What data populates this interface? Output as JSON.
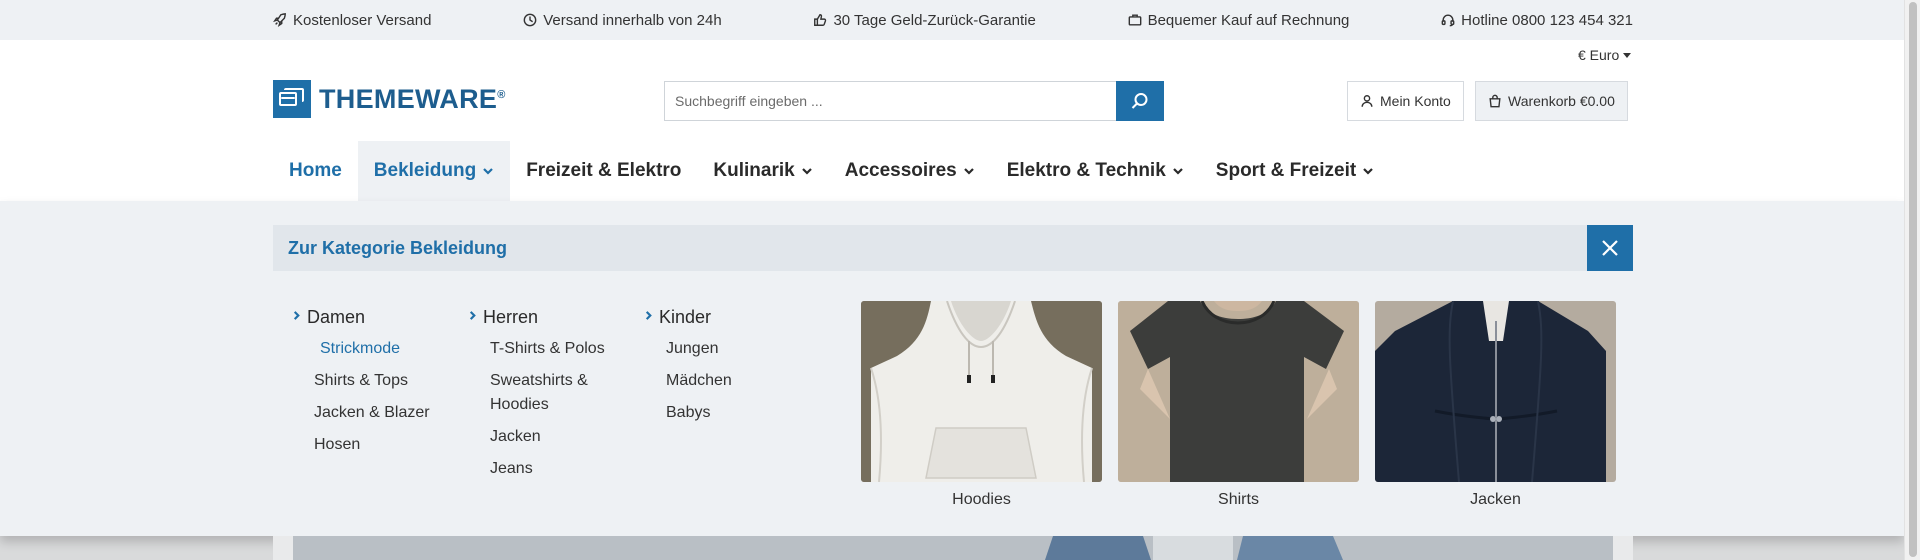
{
  "topbar": {
    "items": [
      {
        "icon": "rocket-icon",
        "label": "Kostenloser Versand"
      },
      {
        "icon": "clock-icon",
        "label": "Versand innerhalb von 24h"
      },
      {
        "icon": "thumbs-up-icon",
        "label": "30 Tage Geld-Zurück-Garantie"
      },
      {
        "icon": "briefcase-icon",
        "label": "Bequemer Kauf auf Rechnung"
      },
      {
        "icon": "headset-icon",
        "label": "Hotline 0800 123 454 321"
      }
    ]
  },
  "header": {
    "currency": "€ Euro",
    "logo_text": "THEMEWARE",
    "logo_mark": "®",
    "search_placeholder": "Suchbegriff eingeben ...",
    "account_label": "Mein Konto",
    "cart_label": "Warenkorb €0.00"
  },
  "nav": {
    "items": [
      {
        "label": "Home",
        "dropdown": false
      },
      {
        "label": "Bekleidung",
        "dropdown": true
      },
      {
        "label": "Freizeit & Elektro",
        "dropdown": false
      },
      {
        "label": "Kulinarik",
        "dropdown": true
      },
      {
        "label": "Accessoires",
        "dropdown": true
      },
      {
        "label": "Elektro & Technik",
        "dropdown": true
      },
      {
        "label": "Sport & Freizeit",
        "dropdown": true
      }
    ]
  },
  "mega": {
    "heading": "Zur Kategorie Bekleidung",
    "columns": [
      {
        "title": "Damen",
        "items": [
          "Strickmode",
          "Shirts & Tops",
          "Jacken & Blazer",
          "Hosen"
        ]
      },
      {
        "title": "Herren",
        "items": [
          "T-Shirts & Polos",
          "Sweatshirts & Hoodies",
          "Jacken",
          "Jeans"
        ]
      },
      {
        "title": "Kinder",
        "items": [
          "Jungen",
          "Mädchen",
          "Babys"
        ]
      }
    ],
    "tiles": [
      {
        "caption": "Hoodies"
      },
      {
        "caption": "Shirts"
      },
      {
        "caption": "Jacken"
      }
    ]
  },
  "colors": {
    "accent": "#1f6fa8",
    "topbar_bg": "#eef1f4",
    "mega_bg": "#eef1f4"
  }
}
